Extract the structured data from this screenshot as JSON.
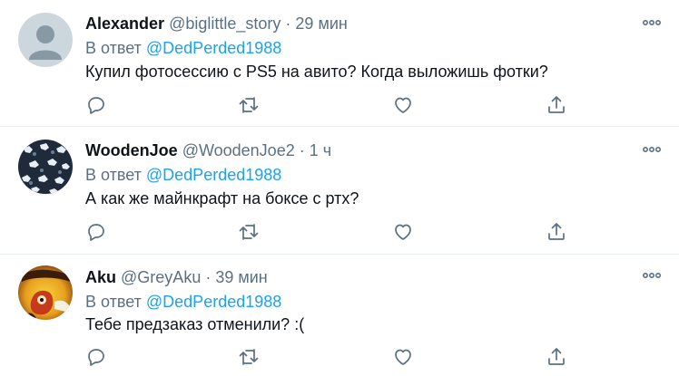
{
  "tweets": [
    {
      "name": "Alexander",
      "handle": "@biglittle_story",
      "separator": "·",
      "time": "29 мин",
      "reply_prefix": "В ответ ",
      "reply_to": "@DedPerded1988",
      "text": "Купил фотосессию с PS5 на авито? Когда выложишь фотки?",
      "avatar": "default-avatar-icon"
    },
    {
      "name": "WoodenJoe",
      "handle": "@WoodenJoe2",
      "separator": "·",
      "time": "1 ч",
      "reply_prefix": "В ответ ",
      "reply_to": "@DedPerded1988",
      "text": "А как же майнкрафт на боксе с ртх?",
      "avatar": "patterned-avatar"
    },
    {
      "name": "Aku",
      "handle": "@GreyAku",
      "separator": "·",
      "time": "39 мин",
      "reply_prefix": "В ответ ",
      "reply_to": "@DedPerded1988",
      "text": "Тебе предзаказ отменили? :(",
      "avatar": "cartoon-avatar"
    }
  ],
  "icons": {
    "more": "more-options-icon",
    "reply": "reply-icon",
    "retweet": "retweet-icon",
    "like": "heart-icon",
    "share": "share-icon"
  },
  "colors": {
    "text": "#0f1419",
    "secondary": "#5b7083",
    "link": "#1da1f2",
    "divider": "#e6ecf0"
  }
}
